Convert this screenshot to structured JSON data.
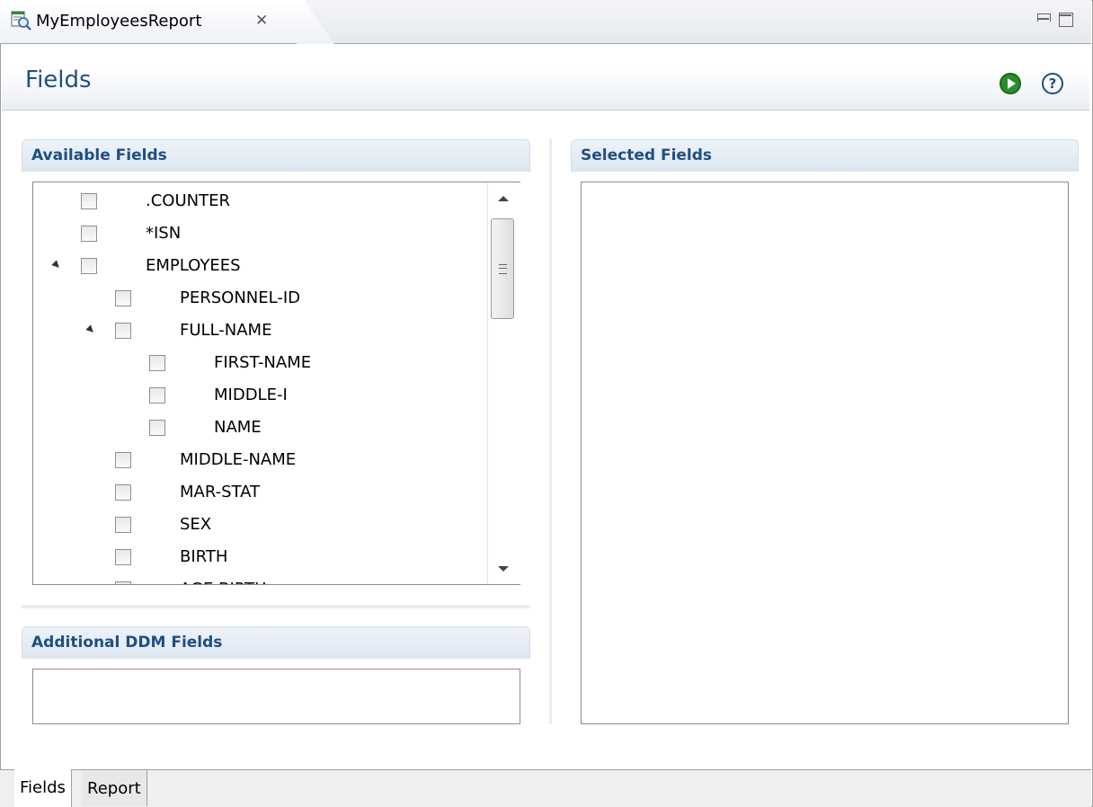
{
  "editor_tab": {
    "title": "MyEmployeesReport",
    "close_glyph": "✕"
  },
  "form": {
    "title": "Fields"
  },
  "header_actions": {
    "run_icon": "run-icon",
    "help_glyph": "?"
  },
  "available_fields": {
    "title": "Available Fields",
    "items": [
      {
        "label": ".COUNTER",
        "level": 0,
        "expandable": false,
        "checked": false
      },
      {
        "label": "*ISN",
        "level": 0,
        "expandable": false,
        "checked": false
      },
      {
        "label": "EMPLOYEES",
        "level": 0,
        "expandable": true,
        "checked": false
      },
      {
        "label": "PERSONNEL-ID",
        "level": 1,
        "expandable": false,
        "checked": false
      },
      {
        "label": "FULL-NAME",
        "level": 1,
        "expandable": true,
        "checked": false
      },
      {
        "label": "FIRST-NAME",
        "level": 2,
        "expandable": false,
        "checked": false
      },
      {
        "label": "MIDDLE-I",
        "level": 2,
        "expandable": false,
        "checked": false
      },
      {
        "label": "NAME",
        "level": 2,
        "expandable": false,
        "checked": false
      },
      {
        "label": "MIDDLE-NAME",
        "level": 1,
        "expandable": false,
        "checked": false
      },
      {
        "label": "MAR-STAT",
        "level": 1,
        "expandable": false,
        "checked": false
      },
      {
        "label": "SEX",
        "level": 1,
        "expandable": false,
        "checked": false
      },
      {
        "label": "BIRTH",
        "level": 1,
        "expandable": false,
        "checked": false
      },
      {
        "label": "AGE-BIRTH",
        "level": 1,
        "expandable": false,
        "checked": false
      }
    ]
  },
  "additional_ddm_fields": {
    "title": "Additional DDM Fields"
  },
  "selected_fields": {
    "title": "Selected Fields"
  },
  "bottom_tabs": [
    {
      "label": "Fields",
      "active": true
    },
    {
      "label": "Report",
      "active": false
    }
  ]
}
